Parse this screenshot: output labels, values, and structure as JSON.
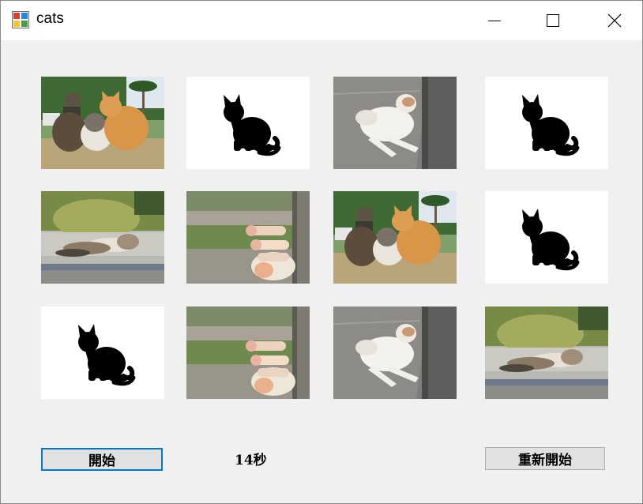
{
  "window": {
    "title": "cats",
    "icons": {
      "app": "app-icon",
      "minimize": "minimize-icon",
      "maximize": "maximize-icon",
      "close": "close-icon"
    }
  },
  "board": {
    "rows": 3,
    "columns": 4,
    "cards": [
      {
        "state": "face-up",
        "image": "cats-group-sitting"
      },
      {
        "state": "face-down",
        "image": "cat-silhouette"
      },
      {
        "state": "face-up",
        "image": "white-cat-leaning-wall"
      },
      {
        "state": "face-down",
        "image": "cat-silhouette"
      },
      {
        "state": "face-up",
        "image": "cats-lying-grass"
      },
      {
        "state": "face-up",
        "image": "cat-paws-against-wall"
      },
      {
        "state": "face-up",
        "image": "cats-group-sitting"
      },
      {
        "state": "face-down",
        "image": "cat-silhouette"
      },
      {
        "state": "face-down",
        "image": "cat-silhouette"
      },
      {
        "state": "face-up",
        "image": "cat-paws-against-wall"
      },
      {
        "state": "face-up",
        "image": "white-cat-leaning-wall"
      },
      {
        "state": "face-up",
        "image": "cats-lying-grass"
      }
    ]
  },
  "controls": {
    "start_label": "開始",
    "timer_text": "14秒",
    "restart_label": "重新開始"
  },
  "colors": {
    "window_bg": "#f0f0f0",
    "titlebar_bg": "#ffffff",
    "focus_border": "#0078d7",
    "button_bg": "#e1e1e1"
  }
}
